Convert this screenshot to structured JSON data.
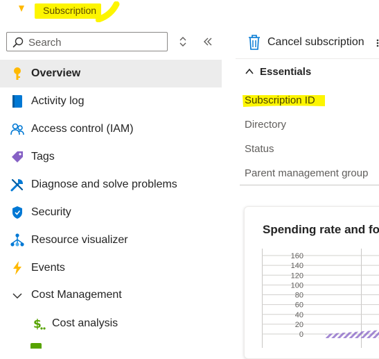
{
  "header": {
    "title": "Subscription"
  },
  "search": {
    "placeholder": "Search"
  },
  "nav": {
    "items": [
      {
        "label": "Overview",
        "icon": "key-icon",
        "selected": true
      },
      {
        "label": "Activity log",
        "icon": "activity-log-icon"
      },
      {
        "label": "Access control (IAM)",
        "icon": "people-icon"
      },
      {
        "label": "Tags",
        "icon": "tag-icon"
      },
      {
        "label": "Diagnose and solve problems",
        "icon": "wrench-icon"
      },
      {
        "label": "Security",
        "icon": "shield-icon"
      },
      {
        "label": "Resource visualizer",
        "icon": "network-icon"
      },
      {
        "label": "Events",
        "icon": "lightning-icon"
      },
      {
        "label": "Cost Management",
        "icon": "chevron-down-icon",
        "expanded": true
      },
      {
        "label": "Cost analysis",
        "icon": "dollar-icon"
      }
    ]
  },
  "toolbar": {
    "cancel_label": "Cancel subscription"
  },
  "essentials": {
    "title": "Essentials",
    "fields": [
      "Subscription ID",
      "Directory",
      "Status",
      "Parent management group"
    ]
  },
  "card": {
    "title": "Spending rate and fo"
  },
  "colors": {
    "highlight": "#fdf500",
    "key": "#ffb900",
    "accent_blue": "#0078d4",
    "bar_purple": "#8661c5"
  },
  "chart_data": {
    "type": "area",
    "title": "Spending rate and fo",
    "y_ticks": [
      160,
      140,
      120,
      100,
      80,
      60,
      40,
      20,
      0
    ],
    "ylim": [
      0,
      160
    ],
    "grid": true,
    "series": [
      {
        "x": [
          0,
          1
        ],
        "values": [
          0,
          8
        ]
      }
    ]
  }
}
